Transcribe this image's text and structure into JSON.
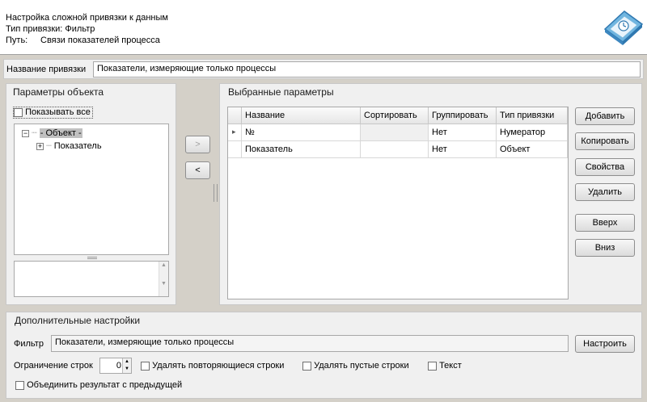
{
  "header": {
    "title": "Настройка сложной привязки к данным",
    "type_line": "Тип привязки: Фильтр",
    "path_label": "Путь:",
    "path_value": "Связи показателей процесса"
  },
  "binding_name": {
    "label": "Название привязки",
    "value": "Показатели, измеряющие только процессы"
  },
  "object_params": {
    "title": "Параметры объекта",
    "show_all_label": "Показывать все",
    "tree": {
      "root": "- Объект -",
      "child": "Показатель"
    }
  },
  "move_buttons": {
    "add": ">",
    "remove": "<"
  },
  "selected_params": {
    "title": "Выбранные параметры",
    "columns": [
      "Название",
      "Сортировать",
      "Группировать",
      "Тип привязки"
    ],
    "rows": [
      {
        "name": "№",
        "sort": "",
        "group": "Нет",
        "type": "Нумератор",
        "current": true
      },
      {
        "name": "Показатель",
        "sort": "",
        "group": "Нет",
        "type": "Объект",
        "current": false
      }
    ],
    "current_marker": "▸"
  },
  "side_buttons": {
    "add": "Добавить",
    "copy": "Копировать",
    "properties": "Свойства",
    "delete": "Удалить",
    "up": "Вверх",
    "down": "Вниз"
  },
  "extra": {
    "title": "Дополнительные настройки",
    "filter_label": "Фильтр",
    "filter_value": "Показатели, измеряющие только процессы",
    "configure_button": "Настроить",
    "row_limit_label": "Ограничение строк",
    "row_limit_value": "0",
    "remove_duplicates_label": "Удалять повторяющиеся строки",
    "remove_empty_label": "Удалять пустые строки",
    "text_label": "Текст",
    "merge_label": "Объединить результат с предыдущей"
  },
  "colors": {
    "background": "#d4d0c8",
    "panel": "#f0f0f0",
    "tree_selection": "#c0c0c0"
  }
}
